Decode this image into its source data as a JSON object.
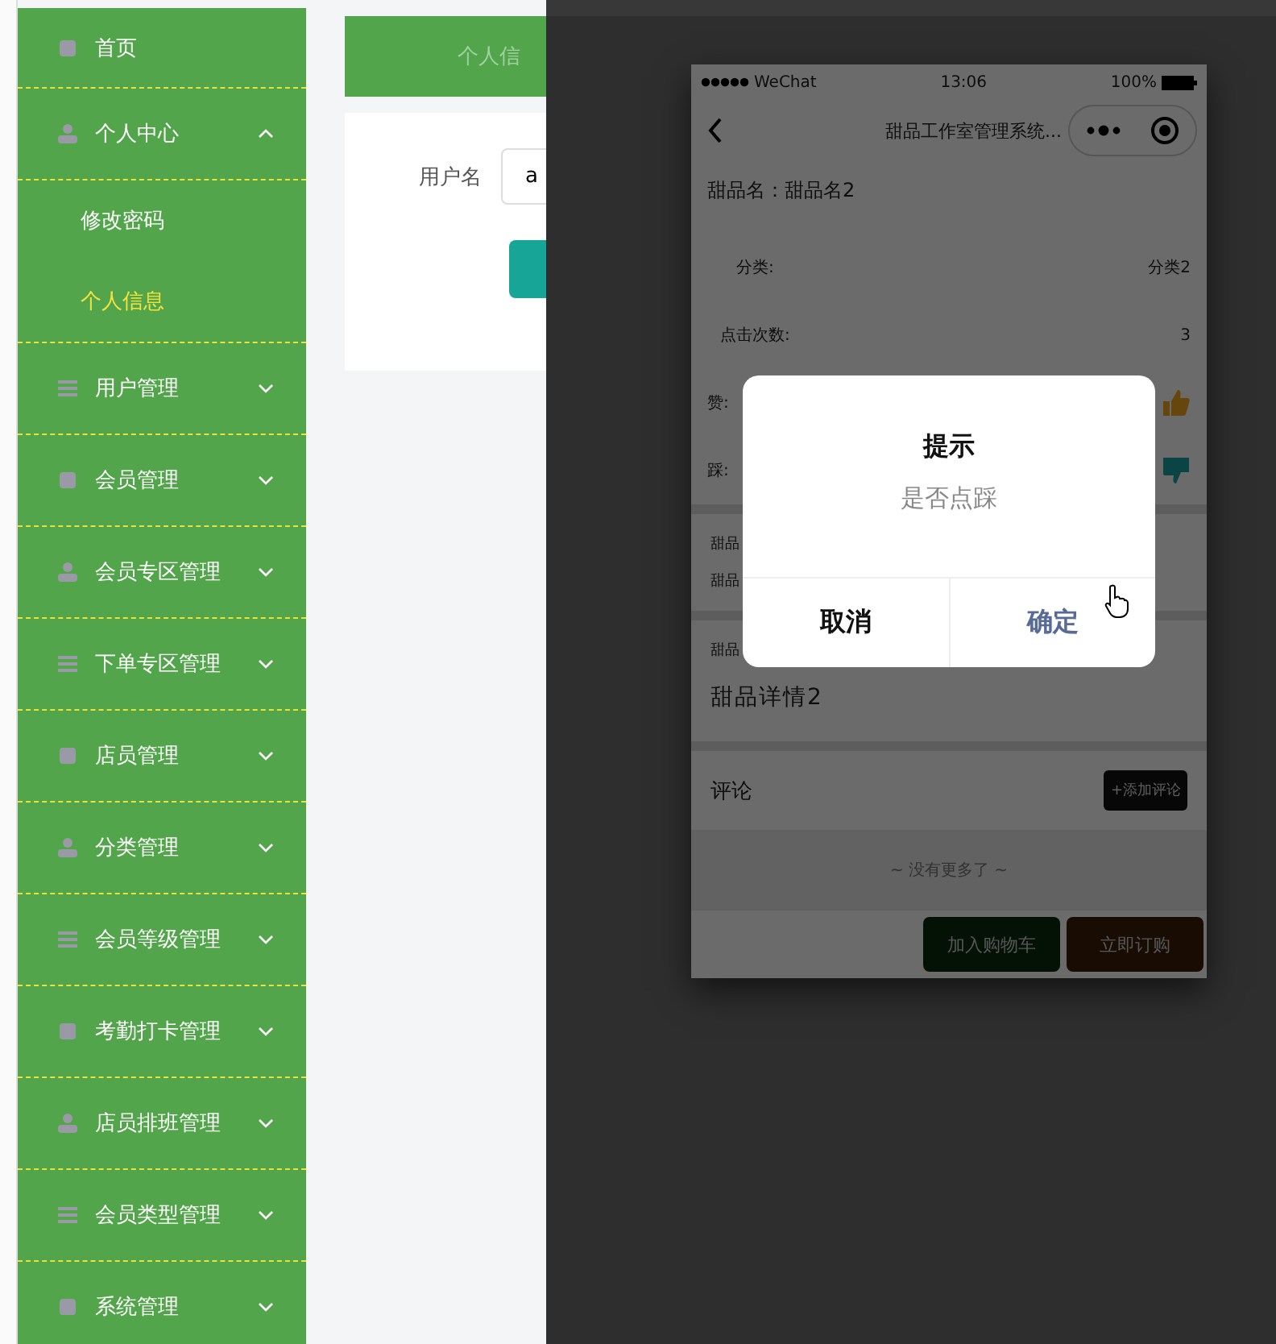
{
  "sidebar": {
    "items": [
      {
        "label": "首页",
        "selected": false
      },
      {
        "label": "个人中心",
        "selected": false,
        "expanded": true,
        "children": [
          {
            "label": "修改密码",
            "selected": false
          },
          {
            "label": "个人信息",
            "selected": true
          }
        ]
      },
      {
        "label": "用户管理",
        "selected": false,
        "expanded": false
      },
      {
        "label": "会员管理",
        "selected": false,
        "expanded": false
      },
      {
        "label": "会员专区管理",
        "selected": false,
        "expanded": false
      },
      {
        "label": "下单专区管理",
        "selected": false,
        "expanded": false
      },
      {
        "label": "店员管理",
        "selected": false,
        "expanded": false
      },
      {
        "label": "分类管理",
        "selected": false,
        "expanded": false
      },
      {
        "label": "会员等级管理",
        "selected": false,
        "expanded": false
      },
      {
        "label": "考勤打卡管理",
        "selected": false,
        "expanded": false
      },
      {
        "label": "店员排班管理",
        "selected": false,
        "expanded": false
      },
      {
        "label": "会员类型管理",
        "selected": false,
        "expanded": false
      },
      {
        "label": "系统管理",
        "selected": false,
        "expanded": false
      }
    ]
  },
  "main": {
    "header": "个人信",
    "form": {
      "label": "用户名",
      "value": "a"
    }
  },
  "phone": {
    "status_bar": {
      "carrier": "WeChat",
      "time": "13:06",
      "battery": "100%"
    },
    "nav_title": "甜品工作室管理系统...",
    "name_line": "甜品名：甜品名2",
    "rows": [
      {
        "label": "分类:",
        "value": "分类2"
      },
      {
        "label": "点击次数:",
        "value": "3"
      }
    ],
    "like_label": "赞:",
    "dislike_label": "踩:",
    "hidden_labels": [
      "甜品",
      "甜品"
    ],
    "detail_label": "甜品",
    "detail": "甜品详情2",
    "comments": {
      "title": "评论",
      "add_button": "+添加评论"
    },
    "footer_note": "~ 没有更多了 ~",
    "actions": [
      "加入购物车",
      "立即订购"
    ],
    "dialog": {
      "title": "提示",
      "message": "是否点踩",
      "cancel": "取消",
      "confirm": "确定"
    }
  }
}
